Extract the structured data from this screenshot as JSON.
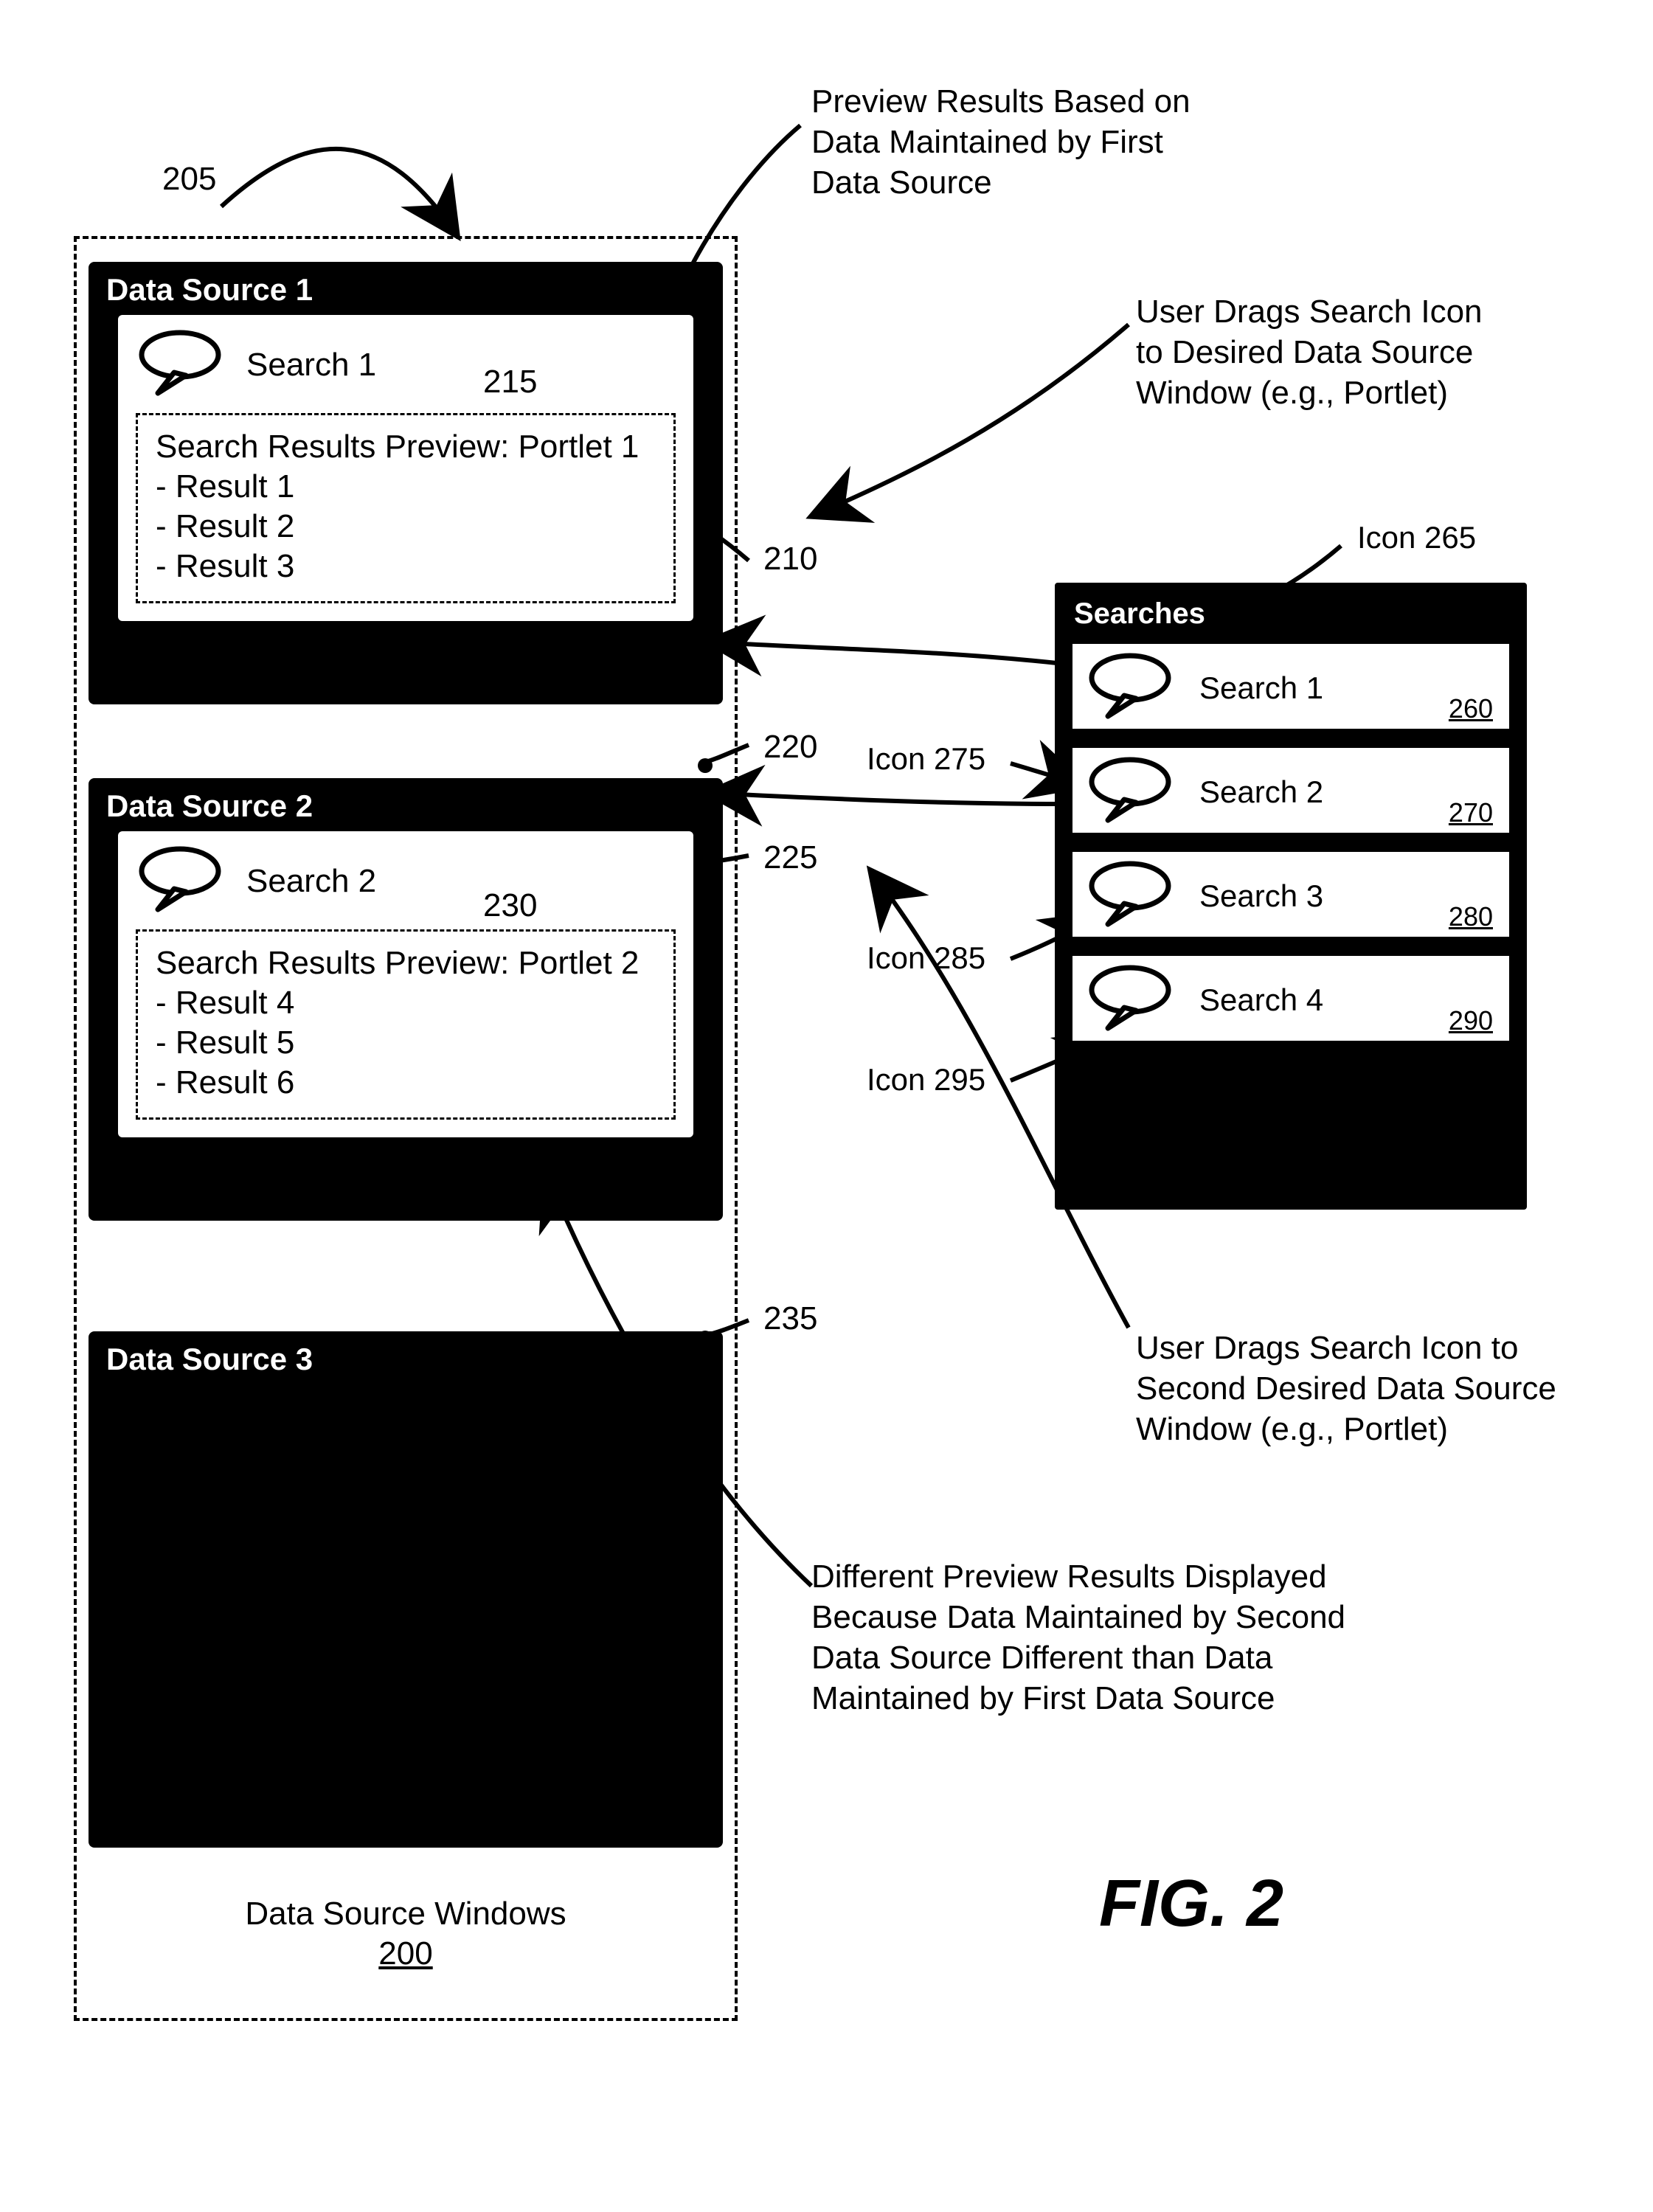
{
  "figure_label": "FIG. 2",
  "callout_205": "205",
  "callout_210": "210",
  "callout_215": "215",
  "callout_220": "220",
  "callout_225": "225",
  "callout_230": "230",
  "callout_235": "235",
  "callout_first_preview_l1": "Preview Results Based on",
  "callout_first_preview_l2": "Data Maintained by First",
  "callout_first_preview_l3": "Data Source",
  "callout_drag1_l1": "User Drags Search Icon",
  "callout_drag1_l2": "to Desired Data Source",
  "callout_drag1_l3": "Window (e.g., Portlet)",
  "callout_drag2_l1": "User Drags Search Icon to",
  "callout_drag2_l2": "Second Desired Data Source",
  "callout_drag2_l3": "Window (e.g., Portlet)",
  "callout_diff_l1": "Different Preview Results Displayed",
  "callout_diff_l2": "Because Data Maintained by Second",
  "callout_diff_l3": "Data Source Different than Data",
  "callout_diff_l4": "Maintained by First Data Source",
  "dsw_label": "Data Source Windows",
  "dsw_ref": "200",
  "icon265_label": "Icon 265",
  "icon275_label": "Icon 275",
  "icon285_label": "Icon 285",
  "icon295_label": "Icon 295",
  "portlets": {
    "p1": {
      "title": "Data Source 1",
      "search_label": "Search 1",
      "preview_title": "Search Results Preview: Portlet 1",
      "r1": "- Result 1",
      "r2": "- Result 2",
      "r3": "- Result 3"
    },
    "p2": {
      "title": "Data Source 2",
      "search_label": "Search 2",
      "preview_title": "Search Results Preview: Portlet 2",
      "r1": "- Result 4",
      "r2": "- Result 5",
      "r3": "- Result 6"
    },
    "p3": {
      "title": "Data Source 3"
    }
  },
  "searches": {
    "title": "Searches",
    "s1": {
      "label": "Search 1",
      "ref": "260"
    },
    "s2": {
      "label": "Search 2",
      "ref": "270"
    },
    "s3": {
      "label": "Search 3",
      "ref": "280"
    },
    "s4": {
      "label": "Search 4",
      "ref": "290"
    }
  }
}
